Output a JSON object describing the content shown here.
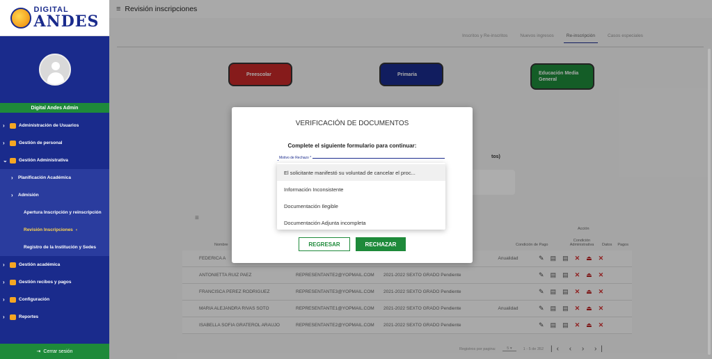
{
  "brand": {
    "line1": "DIGITAL",
    "line2": "ANDES"
  },
  "user": {
    "name": "Digital Andes Admin"
  },
  "sidebar": {
    "items": [
      {
        "label": "Administración de Usuarios",
        "icon": "users-icon"
      },
      {
        "label": "Gestión de personal",
        "icon": "people-icon"
      },
      {
        "label": "Gestión Administrativa",
        "icon": "people-icon"
      },
      {
        "label": "Planificación Académica"
      },
      {
        "label": "Admisión"
      },
      {
        "label": "Apertura Inscripción y reinscripción"
      },
      {
        "label": "Revisión Inscripciones"
      },
      {
        "label": "Registro de la Institución y Sedes"
      },
      {
        "label": "Gestión académica",
        "icon": "bank-icon"
      },
      {
        "label": "Gestión recibos y pagos",
        "icon": "folder-icon"
      },
      {
        "label": "Configuración",
        "icon": "gear-icon"
      },
      {
        "label": "Reportes",
        "icon": "chart-icon"
      }
    ],
    "logout": "Cerrar sesión"
  },
  "header": {
    "title": "Revisión inscripciones"
  },
  "tabs": [
    "Inscritos y Re-inscritos",
    "Nuevos ingresos",
    "Re-inscripción",
    "Casos especiales"
  ],
  "levels": {
    "preescolar": "Preescolar",
    "primaria": "Primaria",
    "media": "Educación Media General"
  },
  "behind_text": "tos)",
  "table": {
    "headers": {
      "name": "Nombre",
      "payment": "Condición de Pago",
      "admin": "Condición Administrativa",
      "action": "Acción",
      "data": "Datos",
      "payments": "Pagos"
    },
    "rows": [
      {
        "name": "FEDERICA A",
        "email": "",
        "period": "",
        "payment": "Anualidad"
      },
      {
        "name": "ANTONIETTA RUIZ PAEZ",
        "email": "REPRESENTANTE2@YOPMAIL.COM",
        "period": "2021-2022 SEXTO GRADO Pendiente",
        "payment": ""
      },
      {
        "name": "FRANCISCA PEREZ RODRIGUEZ",
        "email": "REPRESENTANTE3@YOPMAIL.COM",
        "period": "2021-2022 SEXTO GRADO Pendiente",
        "payment": ""
      },
      {
        "name": "MARIA ALEJANDRA RIVAS SOTO",
        "email": "REPRESENTANTE1@YOPMAIL.COM",
        "period": "2021-2022 SEXTO GRADO Pendiente",
        "payment": "Anualidad"
      },
      {
        "name": "ISABELLA SOFIA GRATEROL ARAUJO",
        "email": "REPRESENTANTE2@YOPMAIL.COM",
        "period": "2021-2022 SEXTO GRADO Pendiente",
        "payment": ""
      }
    ]
  },
  "pager": {
    "label": "Registros por pagina:",
    "per_page": "5",
    "range": "1 - 5 de 352"
  },
  "dialog": {
    "title": "VERIFICACIÓN DE DOCUMENTOS",
    "subtitle": "Complete el siguiente formulario para continuar:",
    "field_label": "Motivo de Rechazo *",
    "options": [
      "El solicitante manifestó su voluntad de cancelar el proc...",
      "Información Inconsistente",
      "Documentación Ilegible",
      "Documentación Adjunta incompleta"
    ],
    "back_label": "REGRESAR",
    "reject_label": "RECHAZAR"
  }
}
